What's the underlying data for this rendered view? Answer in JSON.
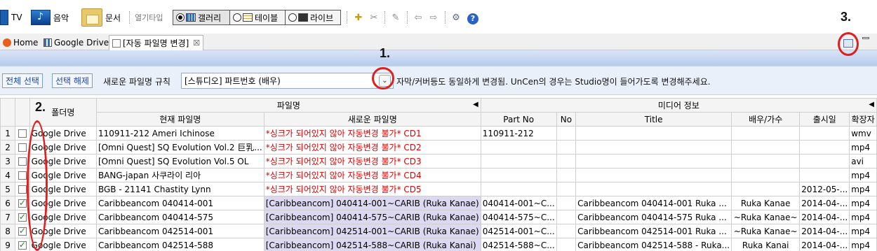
{
  "toolbar": {
    "tv_label": "TV",
    "music_label": "음악",
    "doc_label": "문서",
    "open_type_label": "열기타입",
    "modes": [
      {
        "label": "갤러리",
        "selected": true
      },
      {
        "label": "테이블",
        "selected": false
      },
      {
        "label": "라이브",
        "selected": false
      }
    ],
    "icons": [
      "folder-new-icon",
      "cut-icon",
      "pen-icon",
      "back-arrow-icon",
      "forward-arrow-icon",
      "settings-icon",
      "help-icon"
    ],
    "help_glyph": "?"
  },
  "tabs": [
    {
      "label": "Home",
      "icon": "home-icon"
    },
    {
      "label": "Google Drive",
      "icon": "grid-icon"
    },
    {
      "label": "[자동 파일명 변경]",
      "icon": "page-icon",
      "close": "☒"
    }
  ],
  "controls": {
    "select_all": "전체 선택",
    "deselect": "선택 해제",
    "rule_label": "새로운 파일명 규칙",
    "rule_value": "[스튜디오] 파트번호 (배우)",
    "note": "자막/커버등도 동일하게 변경됨. UnCen의 경우는 Studio명이 들어가도록 변경해주세요."
  },
  "annotations": [
    "1.",
    "2.",
    "3."
  ],
  "grid": {
    "group_headers": {
      "folder": "폴더명",
      "filename": "파일명",
      "media_info": "미디어 정보"
    },
    "columns": {
      "current_name": "현재 파일명",
      "new_name": "새로운 파일명",
      "part_no": "Part No",
      "no": "No",
      "title": "Title",
      "actor": "배우/가수",
      "release": "출시일",
      "ext": "확장자"
    },
    "rows": [
      {
        "num": "1",
        "checked": false,
        "folder": "Google Drive",
        "current": "110911-212 Ameri Ichinose",
        "new": "*싱크가 되어있지 않아 자동변경 불가* CD1",
        "error": true,
        "part_no": "110911-212",
        "no": "",
        "title": "",
        "actor": "",
        "release": "",
        "ext": "wmv"
      },
      {
        "num": "2",
        "checked": false,
        "folder": "Google Drive",
        "current": "[Omni Quest] SQ Evolution Vol.2 巨乳...",
        "new": "*싱크가 되어있지 않아 자동변경 불가* CD2",
        "error": true,
        "part_no": "",
        "no": "",
        "title": "",
        "actor": "",
        "release": "",
        "ext": "mp4"
      },
      {
        "num": "3",
        "checked": false,
        "folder": "Google Drive",
        "current": "[Omni Quest] SQ Evolution Vol.5 OL",
        "new": "*싱크가 되어있지 않아 자동변경 불가* CD3",
        "error": true,
        "part_no": "",
        "no": "",
        "title": "",
        "actor": "",
        "release": "",
        "ext": "avi"
      },
      {
        "num": "4",
        "checked": false,
        "folder": "Google Drive",
        "current": "BANG-japan 사쿠라이 리아",
        "new": "*싱크가 되어있지 않아 자동변경 불가* CD4",
        "error": true,
        "part_no": "",
        "no": "",
        "title": "",
        "actor": "",
        "release": "",
        "ext": "mp4"
      },
      {
        "num": "5",
        "checked": false,
        "folder": "Google Drive",
        "current": "BGB - 21141 Chastity Lynn",
        "new": "*싱크가 되어있지 않아 자동변경 불가* CD5",
        "error": true,
        "part_no": "",
        "no": "",
        "title": "",
        "actor": "",
        "release": "2012-05-...",
        "ext": "mp4"
      },
      {
        "num": "6",
        "checked": true,
        "folder": "Google Drive",
        "current": "Caribbeancom 040414-001",
        "new": "[Caribbeancom] 040414-001~CARIB (Ruka Kanae)",
        "error": false,
        "part_no": "040414-001~C...",
        "no": "",
        "title": "Caribbeancom 040414-001 Ruka ...",
        "actor": "Ruka Kanae",
        "release": "2014-04-...",
        "ext": "mp4"
      },
      {
        "num": "7",
        "checked": true,
        "folder": "Google Drive",
        "current": "Caribbeancom 040414-575",
        "new": "[Caribbeancom] 040414-575~CARIB (Ruka Kanae)",
        "error": false,
        "part_no": "040414-575~C...",
        "no": "",
        "title": "Caribbeancom 040414-575 Ruka ...",
        "actor": "~Ruka Kanae~",
        "release": "2014-04-...",
        "ext": "mp4"
      },
      {
        "num": "8",
        "checked": true,
        "folder": "Google Drive",
        "current": "Caribbeancom 042514-001",
        "new": "[Caribbeancom] 042514-001~CARIB (Ruka Kanae)",
        "error": false,
        "part_no": "042514-001~C...",
        "no": "",
        "title": "Caribbeancom 042514-001 Ruka ...",
        "actor": "~Ruka Kanae~",
        "release": "2014-04-...",
        "ext": "mp4"
      },
      {
        "num": "9",
        "checked": true,
        "folder": "Google Drive",
        "current": "Caribbeancom 042514-588",
        "new": "[Caribbeancom] 042514-588~CARIB (Ruka Kanai)",
        "error": false,
        "part_no": "042514-588~C...",
        "no": "",
        "title": "Caribbeancom 042514-588 - Ruka...",
        "actor": "Ruka Kanai",
        "release": "2014-04-...",
        "ext": "mp4"
      }
    ]
  },
  "colors": {
    "error_text": "#e00000",
    "new_name_bg": "#dcd8f2",
    "annotation_ring": "#e02020",
    "band_blue": "#b7cbeb"
  }
}
